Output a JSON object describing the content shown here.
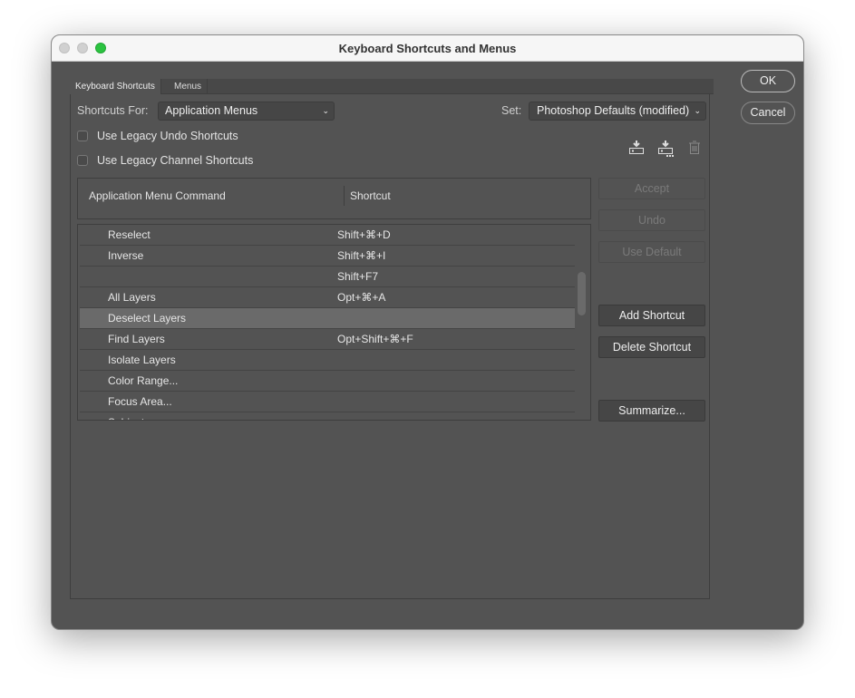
{
  "window": {
    "title": "Keyboard Shortcuts and Menus"
  },
  "tabs": [
    {
      "label": "Keyboard Shortcuts"
    },
    {
      "label": "Menus"
    }
  ],
  "shortcuts_for": {
    "label": "Shortcuts For:",
    "value": "Application Menus"
  },
  "set": {
    "label": "Set:",
    "value": "Photoshop Defaults (modified)"
  },
  "checkboxes": [
    {
      "label": "Use Legacy Undo Shortcuts",
      "checked": false
    },
    {
      "label": "Use Legacy Channel Shortcuts",
      "checked": false
    }
  ],
  "table": {
    "headers": [
      "Application Menu Command",
      "Shortcut"
    ],
    "rows": [
      {
        "command": "Reselect",
        "shortcut": "Shift+⌘+D"
      },
      {
        "command": "Inverse",
        "shortcut": "Shift+⌘+I"
      },
      {
        "command": "",
        "shortcut": "Shift+F7"
      },
      {
        "command": "All Layers",
        "shortcut": "Opt+⌘+A"
      },
      {
        "command": "Deselect Layers",
        "shortcut": "",
        "selected": true
      },
      {
        "command": "Find Layers",
        "shortcut": "Opt+Shift+⌘+F"
      },
      {
        "command": "Isolate Layers",
        "shortcut": ""
      },
      {
        "command": "Color Range...",
        "shortcut": ""
      },
      {
        "command": "Focus Area...",
        "shortcut": ""
      },
      {
        "command": "Subject",
        "shortcut": ""
      }
    ]
  },
  "buttons": {
    "accept": "Accept",
    "undo": "Undo",
    "use_default": "Use Default",
    "add_shortcut": "Add Shortcut",
    "delete_shortcut": "Delete Shortcut",
    "summarize": "Summarize...",
    "ok": "OK",
    "cancel": "Cancel"
  },
  "icons": [
    "save-set-icon",
    "save-set-as-icon",
    "delete-set-icon"
  ]
}
